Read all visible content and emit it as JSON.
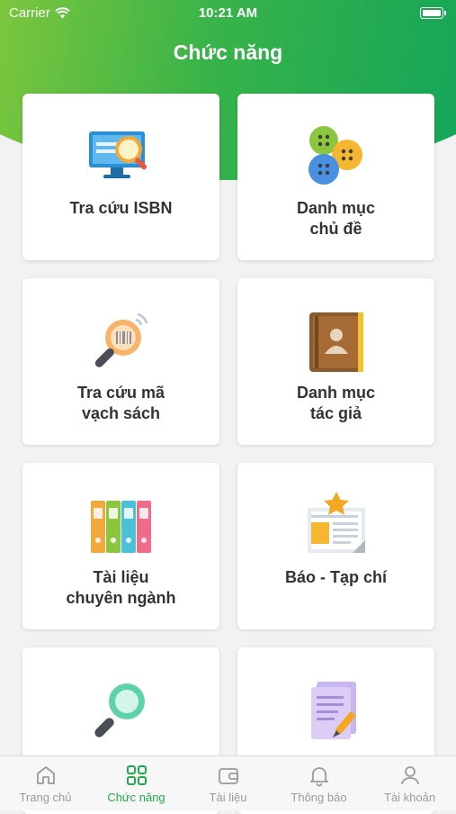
{
  "status_bar": {
    "carrier": "Carrier",
    "time": "10:21 AM"
  },
  "header": {
    "title": "Chức năng"
  },
  "accent_color": "#22a84f",
  "cards": [
    {
      "label": "Tra cứu ISBN",
      "icon": "isbn-search-icon"
    },
    {
      "label": "Danh mục\nchủ đề",
      "icon": "buttons-icon"
    },
    {
      "label": "Tra cứu mã\nvạch sách",
      "icon": "barcode-search-icon"
    },
    {
      "label": "Danh mục\ntác giả",
      "icon": "author-book-icon"
    },
    {
      "label": "Tài liệu\nchuyên ngành",
      "icon": "binders-icon"
    },
    {
      "label": "Báo - Tạp chí",
      "icon": "newspaper-icon"
    },
    {
      "label": "",
      "icon": "magnifier-icon"
    },
    {
      "label": "",
      "icon": "document-icon"
    }
  ],
  "tabbar": {
    "items": [
      {
        "label": "Trang chủ",
        "icon": "home-icon",
        "active": false
      },
      {
        "label": "Chức năng",
        "icon": "grid-icon",
        "active": true
      },
      {
        "label": "Tài liệu",
        "icon": "wallet-icon",
        "active": false
      },
      {
        "label": "Thông báo",
        "icon": "bell-icon",
        "active": false
      },
      {
        "label": "Tài khoản",
        "icon": "user-icon",
        "active": false
      }
    ]
  }
}
